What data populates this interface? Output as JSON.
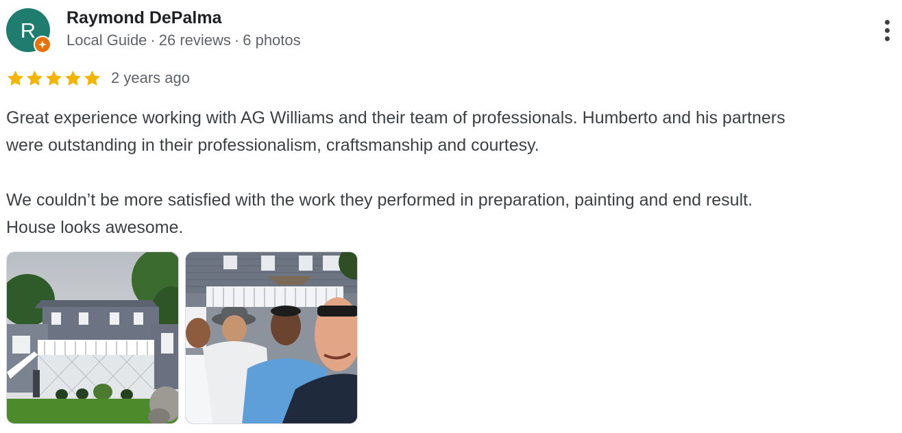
{
  "reviewer": {
    "initial": "R",
    "avatar_color": "#1e7d6e",
    "badge_icon": "local-guide-star-icon",
    "badge_color": "#e8710a",
    "name": "Raymond DePalma",
    "level": "Local Guide",
    "separator": "·",
    "reviews": "26 reviews",
    "photos": "6 photos"
  },
  "menu": {
    "icon": "more-vert-icon"
  },
  "rating": {
    "stars": 5,
    "max_stars": 5,
    "star_color": "#f4b400",
    "date": "2 years ago"
  },
  "review": {
    "paragraph_1_line_1": "Great experience working with AG Williams and their team of professionals. Humberto and his partners",
    "paragraph_1_line_2": "were outstanding in their professionalism, craftsmanship and courtesy.",
    "paragraph_2_line_1": "We couldn’t be more satisfied with the work they performed in preparation, painting and end result.",
    "paragraph_2_line_2": "House looks awesome."
  },
  "photos": [
    {
      "subject": "house-exterior-photo"
    },
    {
      "subject": "group-selfie-photo"
    }
  ]
}
